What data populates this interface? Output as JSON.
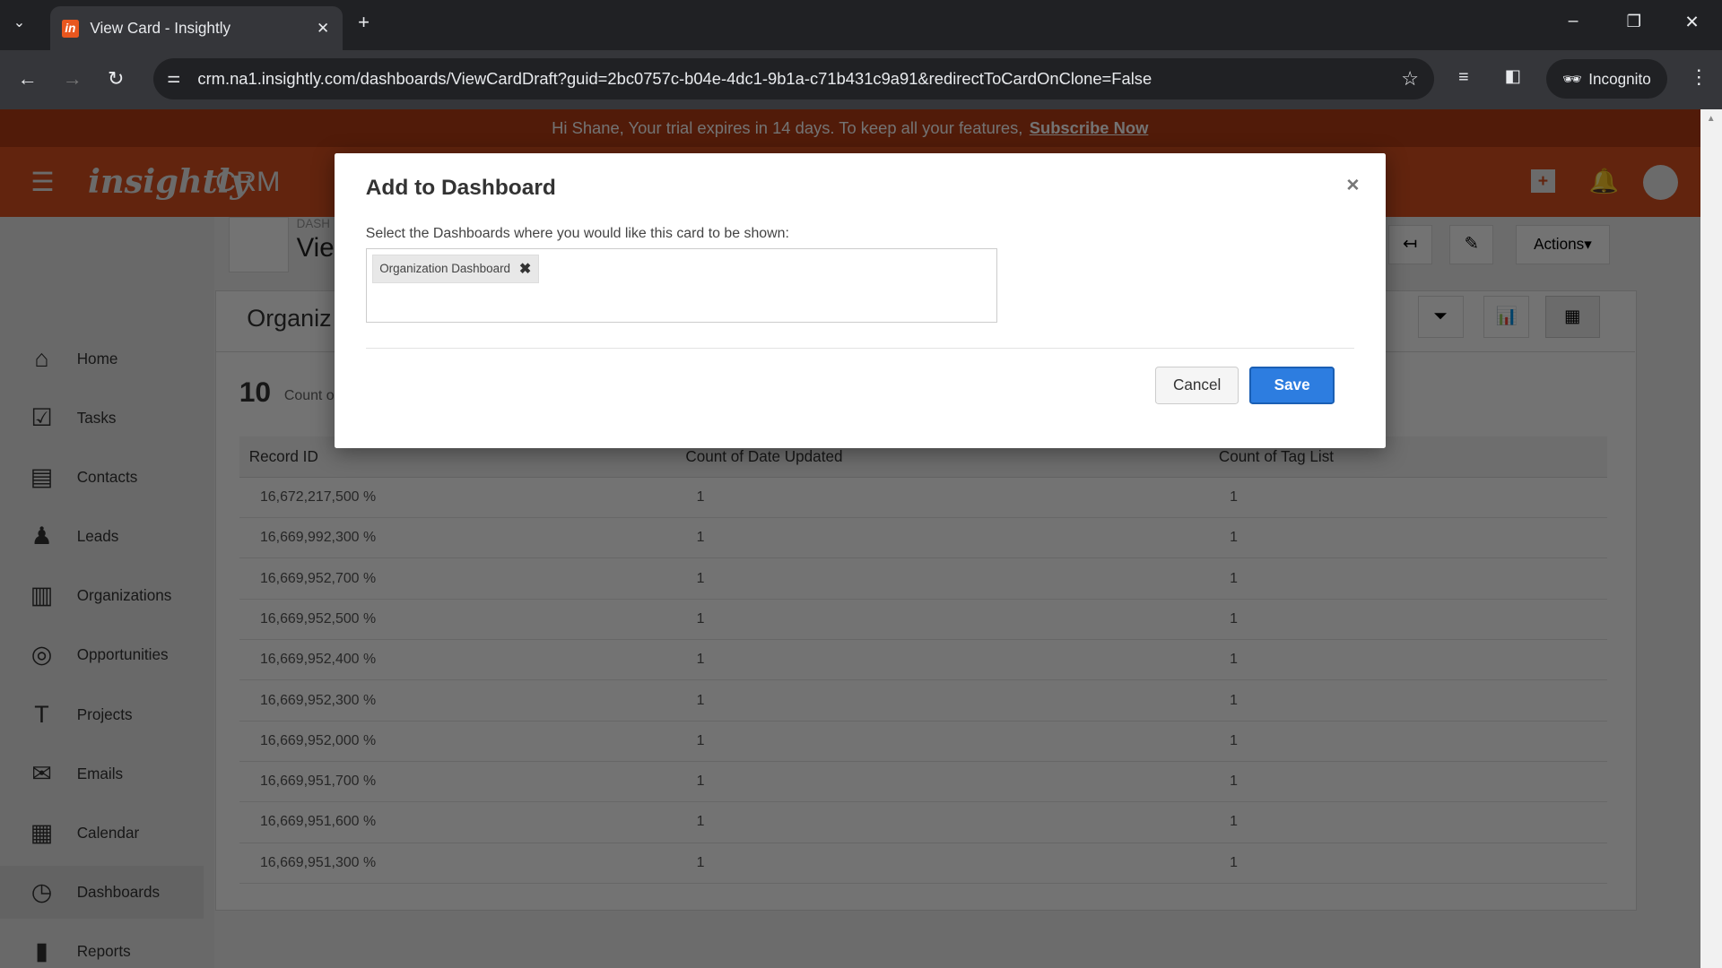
{
  "browser": {
    "tab_title": "View Card - Insightly",
    "url": "crm.na1.insightly.com/dashboards/ViewCardDraft?guid=2bc0757c-b04e-4dc1-9b1a-c71b431c9a91&redirectToCardOnClone=False",
    "incognito_label": "Incognito"
  },
  "banner": {
    "text": "Hi Shane, Your trial expires in 14 days. To keep all your features,",
    "link": "Subscribe Now"
  },
  "header": {
    "logo": "insightly",
    "product": "CRM"
  },
  "sidebar": {
    "items": [
      {
        "label": "Home",
        "icon": "⌂"
      },
      {
        "label": "Tasks",
        "icon": "☑"
      },
      {
        "label": "Contacts",
        "icon": "▤"
      },
      {
        "label": "Leads",
        "icon": "♟"
      },
      {
        "label": "Organizations",
        "icon": "▥"
      },
      {
        "label": "Opportunities",
        "icon": "◎"
      },
      {
        "label": "Projects",
        "icon": "T"
      },
      {
        "label": "Emails",
        "icon": "✉"
      },
      {
        "label": "Calendar",
        "icon": "▦"
      },
      {
        "label": "Dashboards",
        "icon": "◷"
      },
      {
        "label": "Reports",
        "icon": "▮"
      }
    ]
  },
  "page": {
    "breadcrumb": "DASH",
    "title": "Vie",
    "actions_label": "Actions▾",
    "card_title": "Organiz",
    "count": "10",
    "count_label": "Count o"
  },
  "table": {
    "headers": [
      "Record ID",
      "Count of Date Updated",
      "Count of Tag List"
    ],
    "rows": [
      [
        "16,672,217,500 %",
        "1",
        "1"
      ],
      [
        "16,669,992,300 %",
        "1",
        "1"
      ],
      [
        "16,669,952,700 %",
        "1",
        "1"
      ],
      [
        "16,669,952,500 %",
        "1",
        "1"
      ],
      [
        "16,669,952,400 %",
        "1",
        "1"
      ],
      [
        "16,669,952,300 %",
        "1",
        "1"
      ],
      [
        "16,669,952,000 %",
        "1",
        "1"
      ],
      [
        "16,669,951,700 %",
        "1",
        "1"
      ],
      [
        "16,669,951,600 %",
        "1",
        "1"
      ],
      [
        "16,669,951,300 %",
        "1",
        "1"
      ]
    ]
  },
  "dialog": {
    "title": "Add to Dashboard",
    "close": "×",
    "label": "Select the Dashboards where you would like this card to be shown:",
    "selected": [
      "Organization Dashboard"
    ],
    "chip_remove": "✖",
    "cancel": "Cancel",
    "save": "Save"
  }
}
